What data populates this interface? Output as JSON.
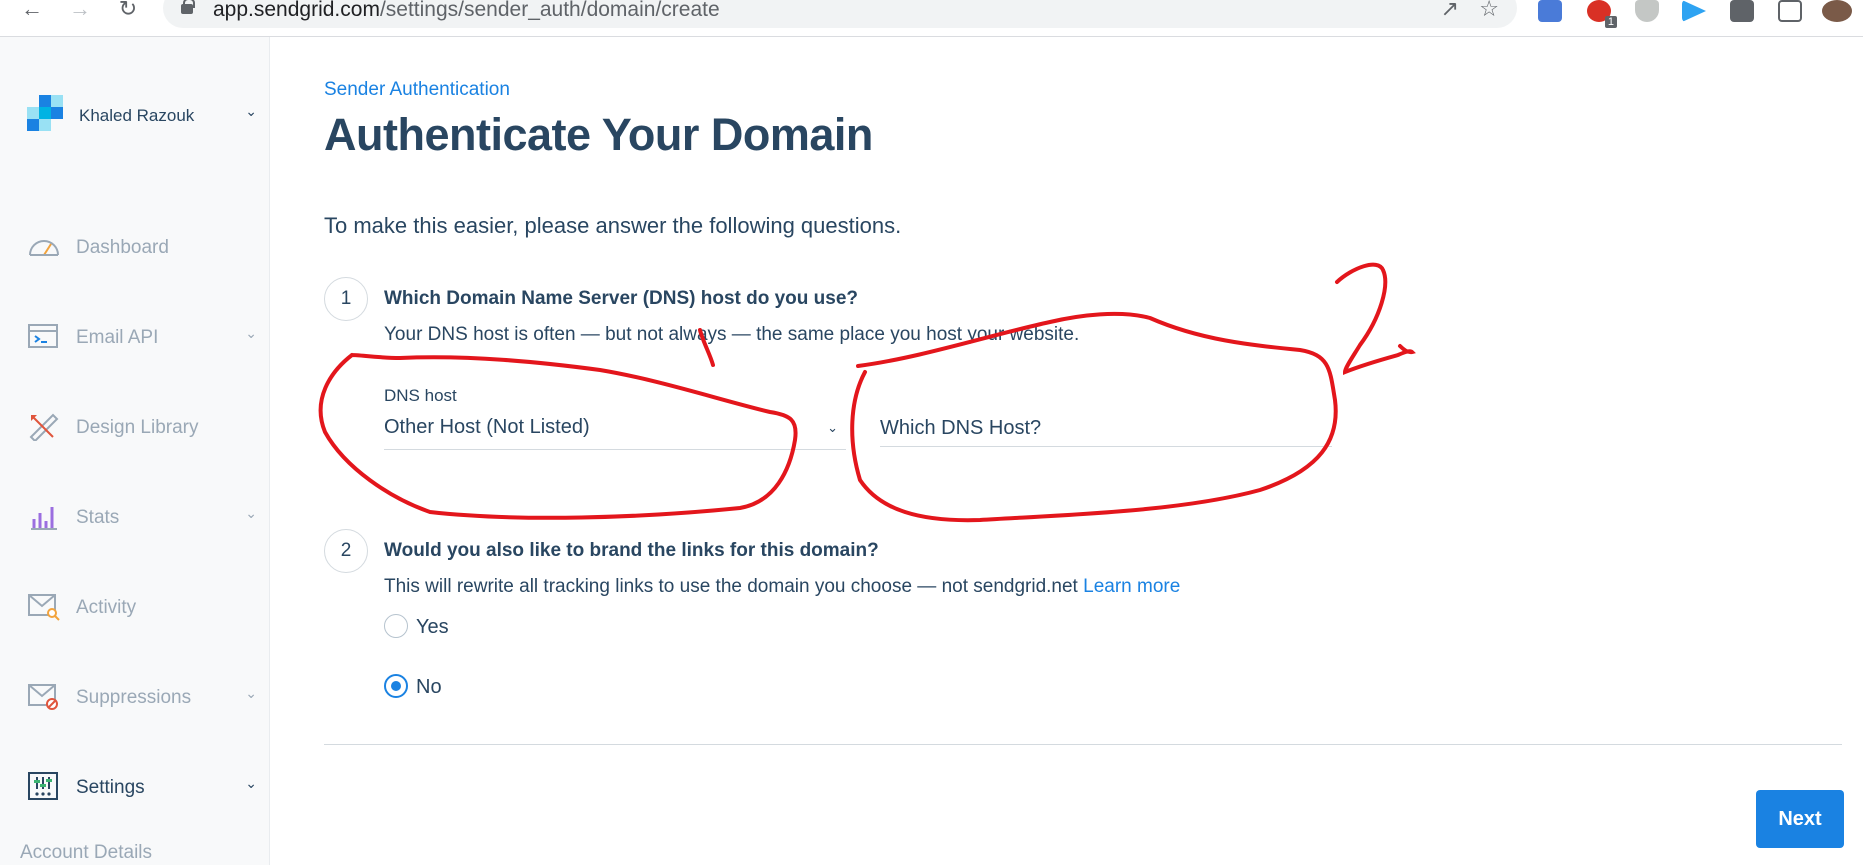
{
  "browser": {
    "url_host": "app.sendgrid.com",
    "url_path": "/settings/sender_auth/domain/create",
    "extension_badge": "1"
  },
  "sidebar": {
    "account_name": "Khaled Razouk",
    "items": [
      {
        "label": "Dashboard",
        "icon": "gauge-icon",
        "has_chevron": false
      },
      {
        "label": "Email API",
        "icon": "terminal-icon",
        "has_chevron": true
      },
      {
        "label": "Design Library",
        "icon": "pencil-ruler-icon",
        "has_chevron": false
      },
      {
        "label": "Stats",
        "icon": "bar-chart-icon",
        "has_chevron": true
      },
      {
        "label": "Activity",
        "icon": "envelope-search-icon",
        "has_chevron": false
      },
      {
        "label": "Suppressions",
        "icon": "envelope-block-icon",
        "has_chevron": true
      },
      {
        "label": "Settings",
        "icon": "sliders-icon",
        "has_chevron": true
      }
    ],
    "sub_item": "Account Details"
  },
  "main": {
    "breadcrumb": "Sender Authentication",
    "title": "Authenticate Your Domain",
    "intro": "To make this easier, please answer the following questions.",
    "q1": {
      "number": "1",
      "title": "Which Domain Name Server (DNS) host do you use?",
      "desc": "Your DNS host is often — but not always — the same place you host your website.",
      "dns_host_label": "DNS host",
      "dns_host_value": "Other Host (Not Listed)",
      "other_host_placeholder": "Which DNS Host?"
    },
    "q2": {
      "number": "2",
      "title": "Would you also like to brand the links for this domain?",
      "desc": "This will rewrite all tracking links to use the domain you choose — not sendgrid.net",
      "learn_more": "Learn more",
      "option_yes": "Yes",
      "option_no": "No",
      "selected": "No"
    },
    "next_label": "Next"
  },
  "annotation": {
    "handwritten_text": "2",
    "color": "#e3161c"
  },
  "colors": {
    "accent": "#1a82e2",
    "text": "#294661",
    "muted": "#9aa8b6"
  }
}
